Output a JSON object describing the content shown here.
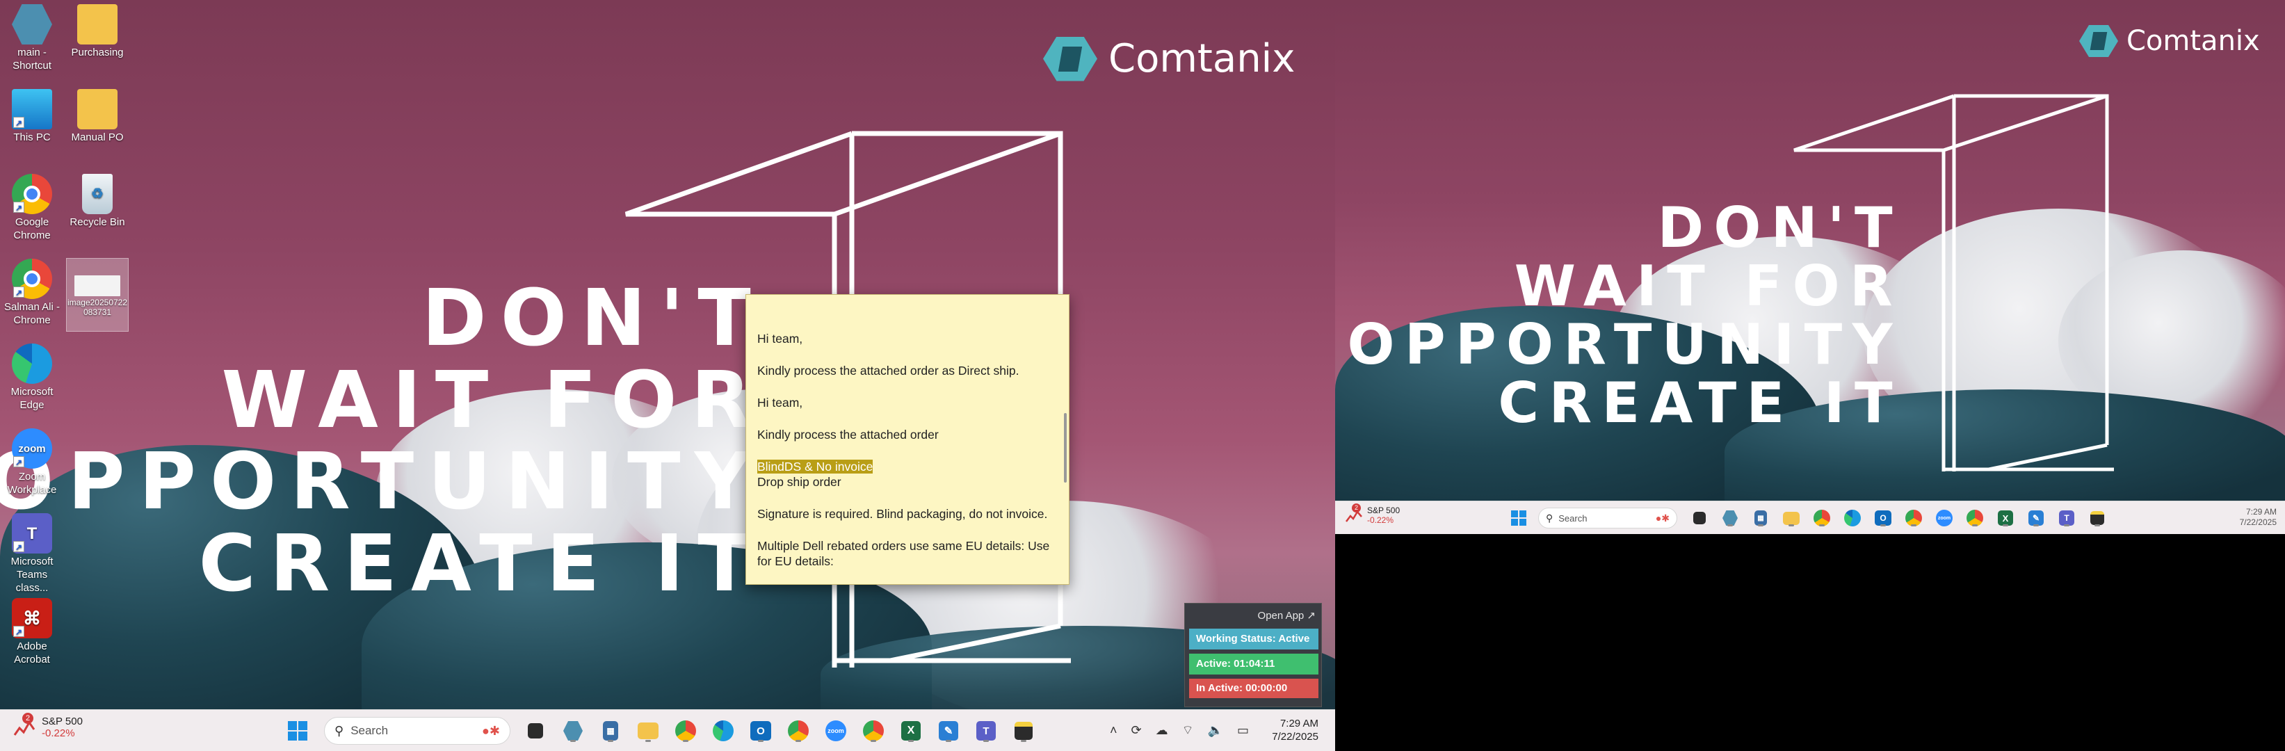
{
  "wallpaper": {
    "brand": "Comtanix",
    "slogan_lines": [
      "DON'T",
      "WAIT FOR",
      "OPPORTUNITY",
      "CREATE IT"
    ]
  },
  "desktop_icons": [
    {
      "label": "main - Shortcut",
      "icon": "hexagon-app-icon",
      "color": "#4c8fb0"
    },
    {
      "label": "Purchasing",
      "icon": "folder-icon",
      "color": "#f3c34b"
    },
    {
      "label": "This PC",
      "icon": "monitor-icon",
      "color": "#2a9bd8"
    },
    {
      "label": "Manual PO",
      "icon": "folder-icon",
      "color": "#f3c34b"
    },
    {
      "label": "Google Chrome",
      "icon": "chrome-icon",
      "color": "#e9473a"
    },
    {
      "label": "Recycle Bin",
      "icon": "recycle-bin-icon",
      "color": "#d7e3ea"
    },
    {
      "label": "Salman Ali - Chrome",
      "icon": "chrome-icon",
      "color": "#e9473a"
    },
    {
      "label": "image20250722083731",
      "icon": "image-file-icon",
      "color": "#e6e6e6"
    },
    {
      "label": "Microsoft Edge",
      "icon": "edge-icon",
      "color": "#1b9be0"
    },
    {
      "label": "Zoom Workplace",
      "icon": "zoom-icon",
      "color": "#2d8cff"
    },
    {
      "label": "Microsoft Teams class...",
      "icon": "teams-icon",
      "color": "#5b5fc7"
    },
    {
      "label": "Adobe Acrobat",
      "icon": "acrobat-icon",
      "color": "#c91f16"
    }
  ],
  "note": {
    "lines": [
      "Hi team,",
      "Kindly process the attached order as Direct ship.",
      "Hi team,",
      "Kindly process the attached order",
      "BlindDS & No invoice",
      "Drop ship order",
      "Signature is required. Blind packaging, do not invoice.",
      "Multiple Dell rebated orders use same EU details: Use for EU details:"
    ]
  },
  "working_status": {
    "open_app": "Open App ↗",
    "status": "Working Status: Active",
    "active": "Active: 01:04:11",
    "inactive": "In Active: 00:00:00",
    "colors": {
      "status": "#4cafc6",
      "active": "#3fbf6f",
      "inactive": "#d9534f"
    }
  },
  "taskbar1": {
    "stock_name": "S&P 500",
    "stock_change": "-0.22%",
    "stock_badge": "2",
    "search_placeholder": "Search",
    "time": "7:29 AM",
    "date": "7/22/2025",
    "apps": [
      "start-icon",
      "file-manager-icon",
      "hexagon-app-icon",
      "calculator-icon",
      "folder-icon",
      "chrome-icon",
      "edge-icon",
      "outlook-icon",
      "chrome-icon",
      "zoom-icon",
      "chrome-icon",
      "excel-icon",
      "snipping-tool-icon",
      "teams-icon",
      "sticky-notes-icon"
    ]
  },
  "taskbar2": {
    "stock_name": "S&P 500",
    "stock_change": "-0.22%",
    "stock_badge": "2",
    "search_placeholder": "Search",
    "time": "7:29 AM",
    "date": "7/22/2025"
  }
}
